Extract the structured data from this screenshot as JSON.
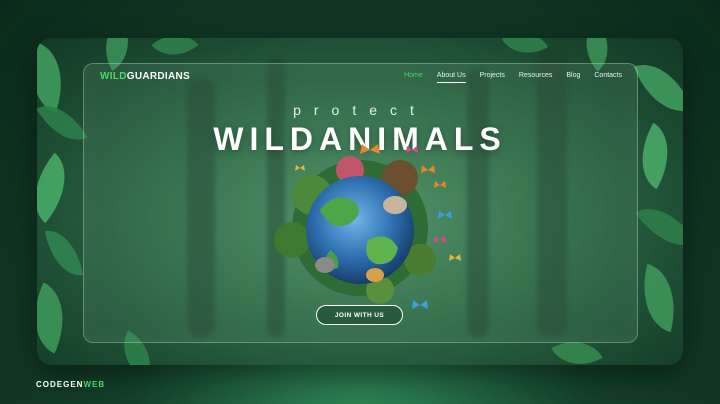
{
  "site": {
    "logo_part1": "WILD",
    "logo_part2": "GUARDIANS",
    "accent_color": "#4cd964"
  },
  "nav": {
    "items": [
      "Home",
      "About Us",
      "Projects",
      "Resources",
      "Blog",
      "Contacts"
    ],
    "active": "Home",
    "underlined": "About Us"
  },
  "hero": {
    "tagline": "protect",
    "headline": "WILDANIMALS",
    "cta_label": "JOIN WITH US",
    "image": "earth-globe-with-animals-and-butterflies"
  },
  "watermark": {
    "part1": "CODEGEN",
    "part2": "WEB"
  }
}
